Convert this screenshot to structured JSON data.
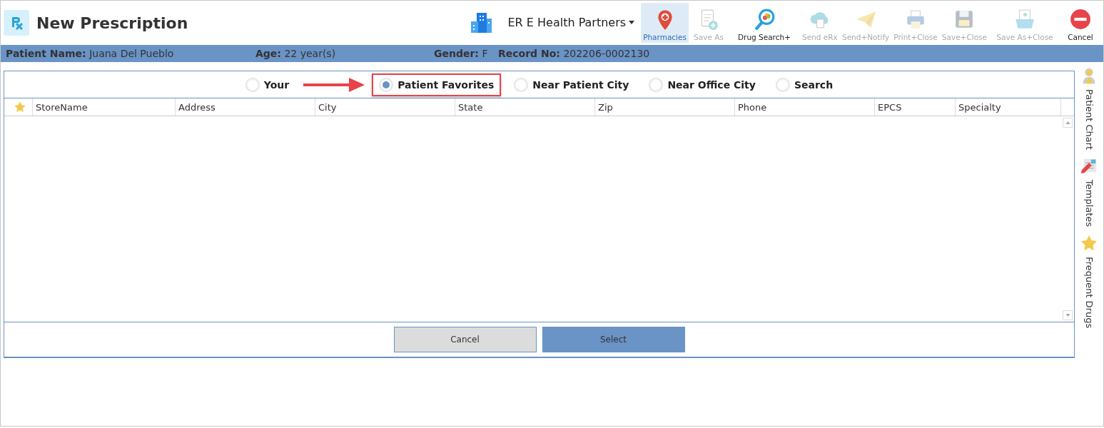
{
  "window": {
    "title": "New Prescription"
  },
  "organization": {
    "name": "ER E Health Partners"
  },
  "toolbar": [
    {
      "label": "Pharmacies",
      "kind": "pin",
      "selected": true,
      "disabled": false
    },
    {
      "label": "Save As",
      "kind": "doc-plus",
      "selected": false,
      "disabled": true
    },
    {
      "label": "Drug Search+",
      "kind": "search",
      "selected": false,
      "disabled": false
    },
    {
      "label": "Send eRx",
      "kind": "cloud",
      "selected": false,
      "disabled": true
    },
    {
      "label": "Send+Notify",
      "kind": "plane",
      "selected": false,
      "disabled": true
    },
    {
      "label": "Print+Close",
      "kind": "printer",
      "selected": false,
      "disabled": true
    },
    {
      "label": "Save+Close",
      "kind": "disk",
      "selected": false,
      "disabled": true
    },
    {
      "label": "Save As+Close",
      "kind": "folder",
      "selected": false,
      "disabled": true
    },
    {
      "label": "Cancel",
      "kind": "stop",
      "selected": false,
      "disabled": false
    }
  ],
  "patient_bar": [
    {
      "label": "Patient Name:",
      "value": "Juana Del Pueblo"
    },
    {
      "label": "Age:",
      "value": "22 year(s)"
    },
    {
      "label": "Gender:",
      "value": "F"
    },
    {
      "label": "Record No:",
      "value": "202206-0002130"
    }
  ],
  "filter_options": [
    {
      "label": "Your",
      "selected": false,
      "callout": false
    },
    {
      "label": "Patient Favorites",
      "selected": true,
      "callout": true
    },
    {
      "label": "Near Patient City",
      "selected": false,
      "callout": false
    },
    {
      "label": "Near Office City",
      "selected": false,
      "callout": false
    },
    {
      "label": "Search",
      "selected": false,
      "callout": false
    }
  ],
  "table": {
    "columns": [
      "StoreName",
      "Address",
      "City",
      "State",
      "Zip",
      "Phone",
      "EPCS",
      "Specialty"
    ]
  },
  "buttons": [
    {
      "label": "Cancel",
      "kind": "secondary"
    },
    {
      "label": "Select",
      "kind": "primary"
    }
  ],
  "side_panel": [
    {
      "label": "Patient Chart",
      "kind": "person"
    },
    {
      "label": "Templates",
      "kind": "pencil"
    },
    {
      "label": "Frequent Drugs",
      "kind": "star"
    }
  ]
}
